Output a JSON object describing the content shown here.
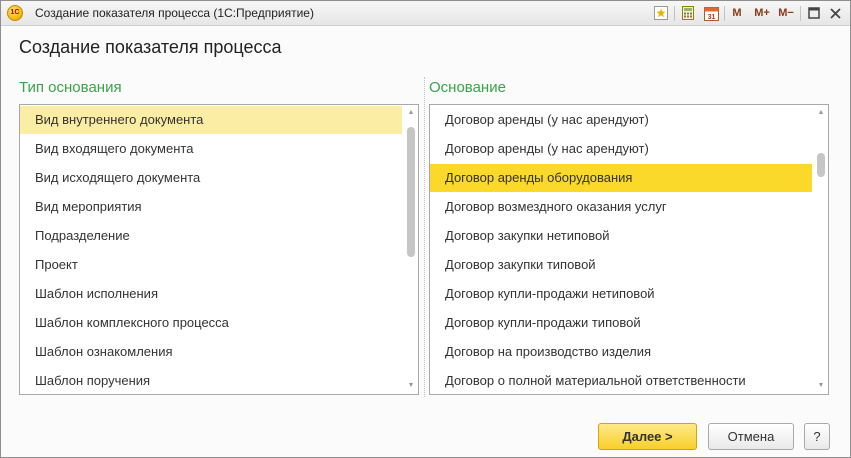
{
  "window": {
    "title": "Создание показателя процесса  (1С:Предприятие)",
    "logo_text": "1C",
    "toolbar": {
      "memory_label": "M",
      "memory_plus_label": "M+",
      "memory_minus_label": "M−"
    }
  },
  "form": {
    "heading": "Создание показателя процесса"
  },
  "left_panel": {
    "label": "Тип основания",
    "items": [
      "Вид внутреннего документа",
      "Вид входящего документа",
      "Вид исходящего документа",
      "Вид мероприятия",
      "Подразделение",
      "Проект",
      "Шаблон исполнения",
      "Шаблон комплексного процесса",
      "Шаблон ознакомления",
      "Шаблон поручения"
    ],
    "selected_index": 0
  },
  "right_panel": {
    "label": "Основание",
    "items": [
      "Договор аренды (у нас арендуют)",
      "Договор аренды (у нас арендуют)",
      "Договор аренды оборудования",
      "Договор возмездного оказания услуг",
      "Договор закупки нетиповой",
      "Договор закупки типовой",
      "Договор купли-продажи нетиповой",
      "Договор купли-продажи типовой",
      "Договор на производство изделия",
      "Договор о полной материальной ответственности"
    ],
    "selected_index": 2
  },
  "buttons": {
    "next_label": "Далее >",
    "cancel_label": "Отмена",
    "help_label": "?"
  },
  "colors": {
    "panel_label": "#3aa24a",
    "selection_inactive": "#fbeda3",
    "selection_active": "#fad92a",
    "primary_button": "#f7cf2a"
  }
}
